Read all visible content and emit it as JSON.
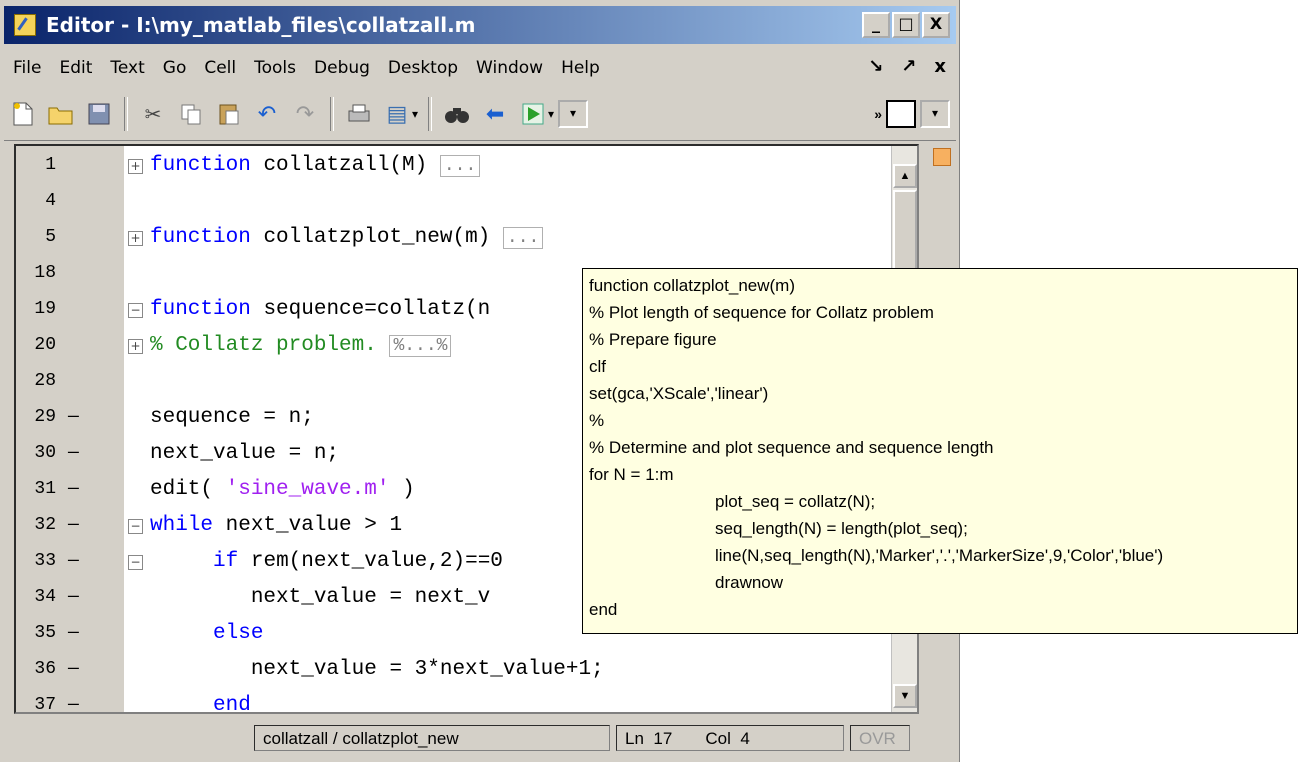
{
  "window": {
    "title": "Editor - I:\\my_matlab_files\\collatzall.m",
    "controls": [
      "_",
      "□",
      "X"
    ]
  },
  "menu": {
    "items": [
      "File",
      "Edit",
      "Text",
      "Go",
      "Cell",
      "Tools",
      "Debug",
      "Desktop",
      "Window",
      "Help"
    ],
    "right": [
      "↘",
      "↗",
      "x"
    ]
  },
  "editor": {
    "lines": [
      {
        "num": "1",
        "dash": "",
        "fold": "+",
        "parts": [
          [
            "kw",
            "function"
          ],
          [
            "",
            "collatzall(M)"
          ],
          [
            "box",
            "..."
          ]
        ]
      },
      {
        "num": "4",
        "dash": "",
        "fold": "",
        "parts": []
      },
      {
        "num": "5",
        "dash": "",
        "fold": "+",
        "parts": [
          [
            "kw",
            "function"
          ],
          [
            "",
            "collatzplot_new(m)"
          ],
          [
            "box",
            "..."
          ]
        ]
      },
      {
        "num": "18",
        "dash": "",
        "fold": "",
        "parts": []
      },
      {
        "num": "19",
        "dash": "",
        "fold": "-",
        "parts": [
          [
            "kw",
            "function"
          ],
          [
            "",
            "sequence=collatz(n"
          ]
        ]
      },
      {
        "num": "20",
        "dash": "",
        "fold": "+",
        "parts": [
          [
            "cm",
            "% Collatz problem."
          ],
          [
            "box",
            "%...%"
          ]
        ]
      },
      {
        "num": "28",
        "dash": "",
        "fold": "",
        "parts": []
      },
      {
        "num": "29",
        "dash": "-",
        "fold": "",
        "parts": [
          [
            "",
            "sequence = n;"
          ]
        ]
      },
      {
        "num": "30",
        "dash": "-",
        "fold": "",
        "parts": [
          [
            "",
            "next_value = n;"
          ]
        ]
      },
      {
        "num": "31",
        "dash": "-",
        "fold": "",
        "parts": [
          [
            "",
            "edit("
          ],
          [
            "str",
            "'sine_wave.m'"
          ],
          [
            "",
            ")"
          ]
        ]
      },
      {
        "num": "32",
        "dash": "-",
        "fold": "-",
        "parts": [
          [
            "kw",
            "while"
          ],
          [
            "",
            "next_value > 1"
          ]
        ]
      },
      {
        "num": "33",
        "dash": "-",
        "fold": "-",
        "parts": [
          [
            "",
            "    "
          ],
          [
            "kw",
            "if"
          ],
          [
            "",
            "rem(next_value,2)==0"
          ]
        ]
      },
      {
        "num": "34",
        "dash": "-",
        "fold": "",
        "parts": [
          [
            "",
            "        next_value = next_v"
          ]
        ]
      },
      {
        "num": "35",
        "dash": "-",
        "fold": "",
        "parts": [
          [
            "",
            "    "
          ],
          [
            "kw",
            "else"
          ]
        ]
      },
      {
        "num": "36",
        "dash": "-",
        "fold": "",
        "parts": [
          [
            "",
            "        next_value = 3*next_value+1;"
          ]
        ]
      },
      {
        "num": "37",
        "dash": "-",
        "fold": "",
        "parts": [
          [
            "",
            "    "
          ],
          [
            "kw",
            "end"
          ]
        ]
      }
    ]
  },
  "tooltip": {
    "lines": [
      {
        "indent": false,
        "text": "function collatzplot_new(m)"
      },
      {
        "indent": false,
        "text": "% Plot length of sequence for Collatz problem"
      },
      {
        "indent": false,
        "text": "% Prepare figure"
      },
      {
        "indent": false,
        "text": "clf"
      },
      {
        "indent": false,
        "text": "set(gca,'XScale','linear')"
      },
      {
        "indent": false,
        "text": "%"
      },
      {
        "indent": false,
        "text": "% Determine and plot sequence and sequence length"
      },
      {
        "indent": false,
        "text": "for N = 1:m"
      },
      {
        "indent": true,
        "text": "plot_seq = collatz(N);"
      },
      {
        "indent": true,
        "text": "seq_length(N) = length(plot_seq);"
      },
      {
        "indent": true,
        "text": "line(N,seq_length(N),'Marker','.','MarkerSize',9,'Color','blue')"
      },
      {
        "indent": true,
        "text": "drawnow"
      },
      {
        "indent": false,
        "text": "end"
      }
    ]
  },
  "status": {
    "function_path": "collatzall / collatzplot_new",
    "ln_label": "Ln",
    "ln_value": "17",
    "col_label": "Col",
    "col_value": "4",
    "ovr": "OVR"
  },
  "colors": {
    "keyword": "#0000ff",
    "string": "#a020f0",
    "comment": "#228b22",
    "tooltip_bg": "#ffffe1"
  }
}
